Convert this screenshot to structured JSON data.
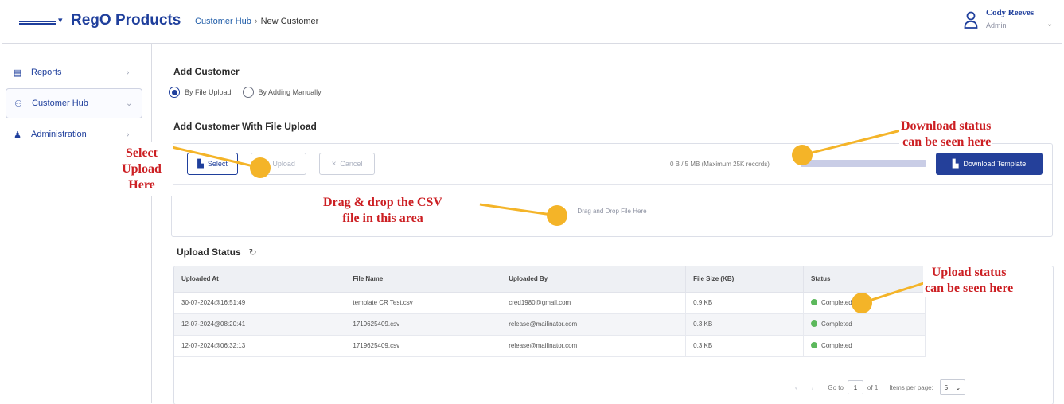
{
  "header": {
    "brand": "RegO Products",
    "breadcrumb": [
      "Customer Hub",
      "New Customer"
    ],
    "breadcrumb_sep": "›",
    "user_name": "Cody Reeves",
    "user_role": "Admin"
  },
  "sidebar": {
    "items": [
      {
        "label": "Reports",
        "icon": "document-icon"
      },
      {
        "label": "Customer Hub",
        "icon": "people-icon"
      },
      {
        "label": "Administration",
        "icon": "admin-icon"
      }
    ]
  },
  "main": {
    "title": "Add Customer",
    "radio_file": "By File Upload",
    "radio_manual": "By Adding Manually",
    "subtitle": "Add Customer With File Upload",
    "select_label": "Select",
    "upload_label": "Upload",
    "cancel_label": "Cancel",
    "size_text": "0 B / 5 MB (Maximum 25K records)",
    "download_label": "Download Template",
    "drop_text": "Drag and Drop File Here",
    "status_title": "Upload Status",
    "table": {
      "headers": [
        "Uploaded At",
        "File Name",
        "Uploaded By",
        "File Size (KB)",
        "Status"
      ],
      "rows": [
        [
          "30-07-2024@16:51:49",
          "template CR Test.csv",
          "cred1980@gmail.com",
          "0.9 KB",
          "Completed"
        ],
        [
          "12-07-2024@08:20:41",
          "1719625409.csv",
          "release@mailinator.com",
          "0.3 KB",
          "Completed"
        ],
        [
          "12-07-2024@06:32:13",
          "1719625409.csv",
          "release@mailinator.com",
          "0.3 KB",
          "Completed"
        ]
      ]
    },
    "pager": {
      "goto": "Go to",
      "page": "1",
      "of": "of 1",
      "items_per_page": "Items per page:",
      "per_page_value": "5"
    }
  },
  "annotations": {
    "select_upload": [
      "Select",
      "Upload",
      "Here"
    ],
    "download_status": [
      "Download status",
      "can be seen here"
    ],
    "drag_drop": [
      "Drag & drop the CSV",
      "file in this area"
    ],
    "upload_status": [
      "Upload status",
      "can be seen here"
    ]
  },
  "colors": {
    "brand": "#1f3f9c",
    "annotation_text": "#cc1f23",
    "annotation_marker": "#f4b428",
    "status_ok": "#5cb85c"
  }
}
